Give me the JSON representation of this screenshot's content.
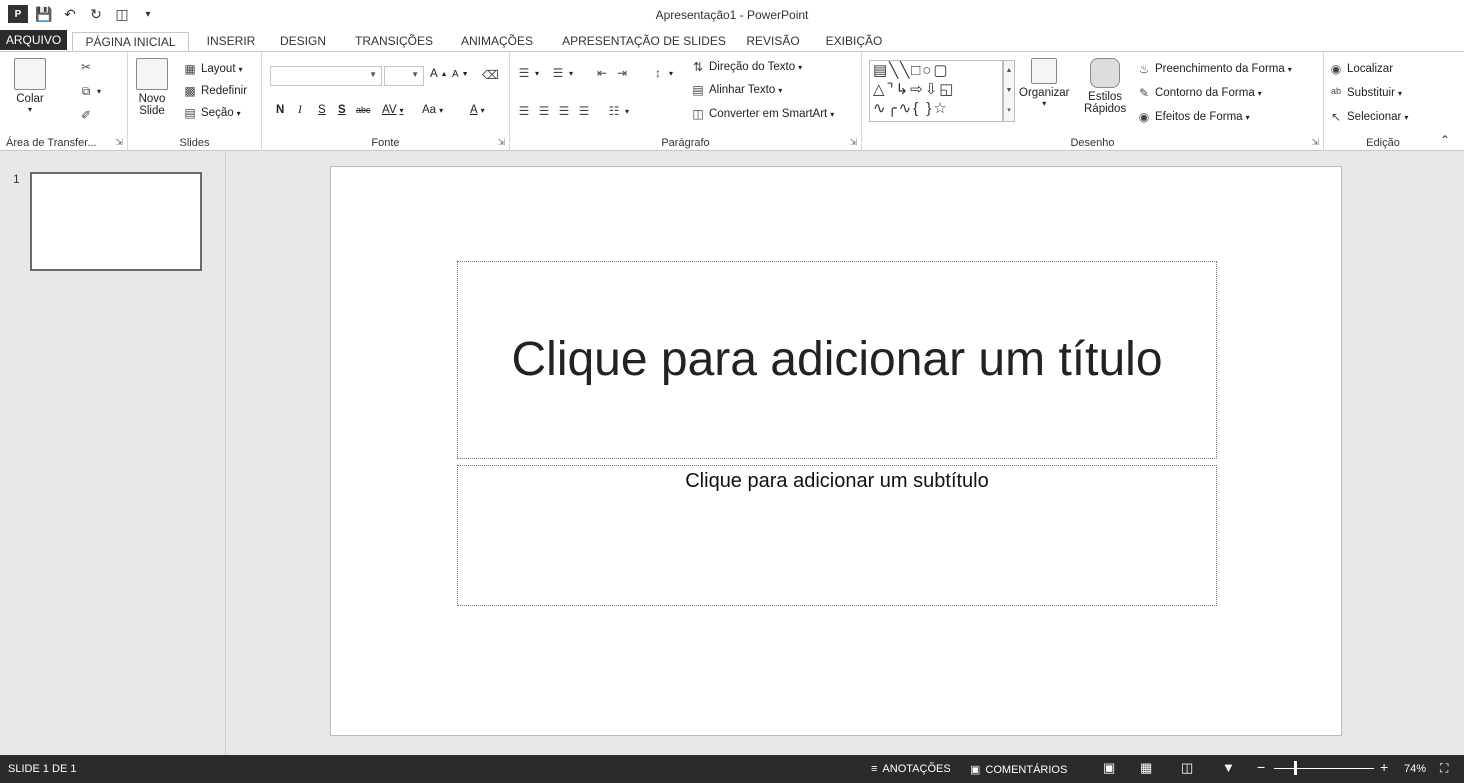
{
  "app": {
    "title": "Apresentação1 - PowerPoint"
  },
  "tabs": [
    "ARQUIVO",
    "PÁGINA INICIAL",
    "INSERIR",
    "DESIGN",
    "TRANSIÇÕES",
    "ANIMAÇÕES",
    "APRESENTAÇÃO DE SLIDES",
    "REVISÃO",
    "EXIBIÇÃO"
  ],
  "ribbon": {
    "clipboard": {
      "label": "Área de Transfer...",
      "paste": "Colar"
    },
    "slides": {
      "label": "Slides",
      "new_slide_1": "Novo",
      "new_slide_2": "Slide",
      "layout": "Layout",
      "reset": "Redefinir",
      "section": "Seção"
    },
    "font": {
      "label": "Fonte",
      "font_name": "",
      "font_size": "",
      "bold": "N",
      "italic": "I",
      "underline": "S",
      "shadow": "S",
      "strike": "abc",
      "spacing": "AV",
      "case": "Aa",
      "color": "A",
      "grow": "A",
      "shrink": "A"
    },
    "paragraph": {
      "label": "Parágrafo",
      "direction": "Direção do Texto",
      "align": "Alinhar Texto",
      "smartart": "Converter em SmartArt"
    },
    "drawing": {
      "label": "Desenho",
      "arrange": "Organizar",
      "quick_1": "Estilos",
      "quick_2": "Rápidos",
      "fill": "Preenchimento da Forma",
      "outline": "Contorno da Forma",
      "effects": "Efeitos de Forma"
    },
    "editing": {
      "label": "Edição",
      "find": "Localizar",
      "replace": "Substituir",
      "select": "Selecionar"
    }
  },
  "thumbnails": [
    {
      "number": "1"
    }
  ],
  "slide": {
    "title_placeholder": "Clique para adicionar um título",
    "subtitle_placeholder": "Clique para adicionar um subtítulo"
  },
  "status": {
    "slide_info": "SLIDE 1 DE 1",
    "notes": "ANOTAÇÕES",
    "comments": "COMENTÁRIOS",
    "zoom": "74%"
  },
  "colors": {
    "status_bg": "#2b2b2b",
    "file_tab_bg": "#2b2b2b",
    "canvas_bg": "#e8e8e8"
  }
}
